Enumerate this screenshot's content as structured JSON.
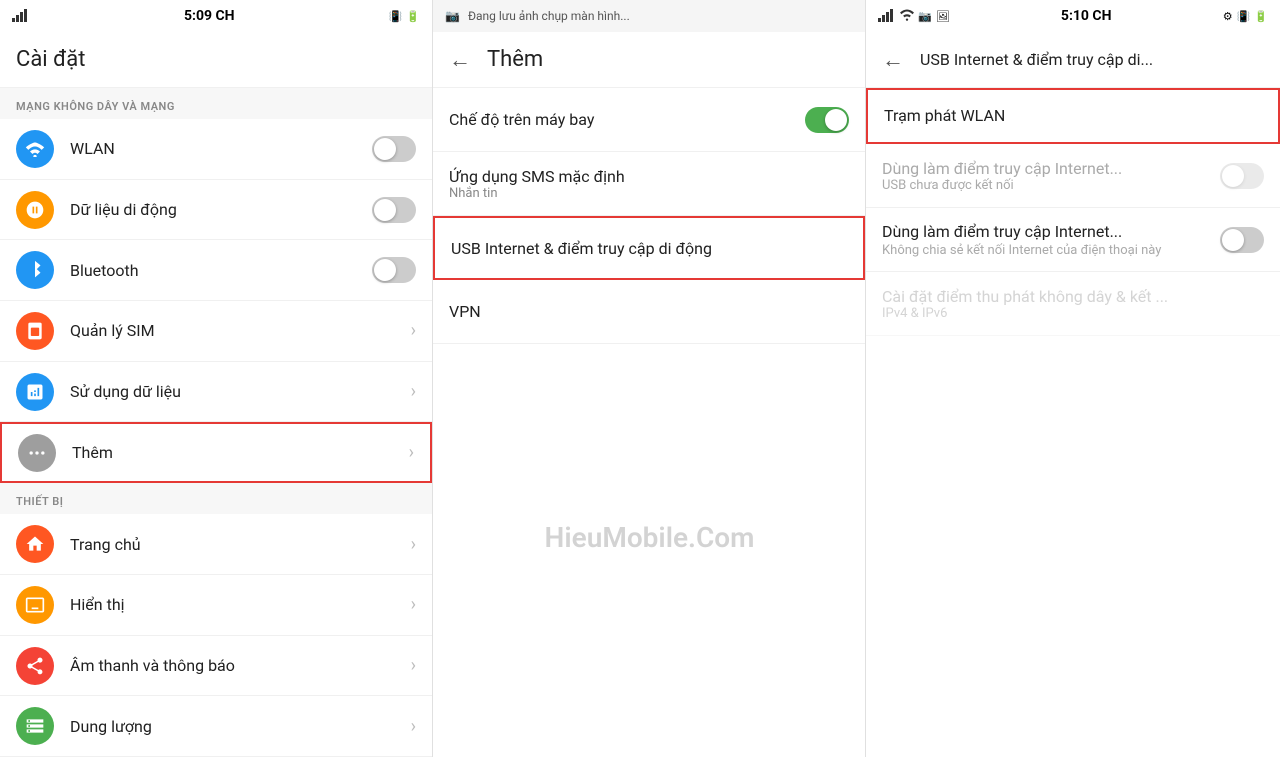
{
  "panel1": {
    "status_time": "5:09 CH",
    "title": "Cài đặt",
    "section1_header": "MẠNG KHÔNG DÂY VÀ MẠNG",
    "items": [
      {
        "id": "wlan",
        "label": "WLAN",
        "icon": "wifi",
        "icon_color": "#2196F3",
        "has_toggle": true,
        "toggle_on": false
      },
      {
        "id": "mobile_data",
        "label": "Dữ liệu di động",
        "icon": "signal",
        "icon_color": "#FF9800",
        "has_toggle": true,
        "toggle_on": false
      },
      {
        "id": "bluetooth",
        "label": "Bluetooth",
        "icon": "bluetooth",
        "icon_color": "#2196F3",
        "has_toggle": true,
        "toggle_on": false
      },
      {
        "id": "sim",
        "label": "Quản lý SIM",
        "icon": "sim",
        "icon_color": "#FF5722",
        "has_toggle": false,
        "has_chevron": true
      },
      {
        "id": "data_usage",
        "label": "Sử dụng dữ liệu",
        "icon": "data",
        "icon_color": "#2196F3",
        "has_toggle": false,
        "has_chevron": true
      },
      {
        "id": "more",
        "label": "Thêm",
        "icon": "more",
        "icon_color": "#9E9E9E",
        "has_toggle": false,
        "has_chevron": true,
        "highlighted": true
      }
    ],
    "section2_header": "THIẾT BỊ",
    "items2": [
      {
        "id": "home",
        "label": "Trang chủ",
        "icon": "home",
        "icon_color": "#FF5722",
        "has_chevron": true
      },
      {
        "id": "display",
        "label": "Hiển thị",
        "icon": "display",
        "icon_color": "#FF9800",
        "has_chevron": true
      },
      {
        "id": "sound",
        "label": "Âm thanh và thông báo",
        "icon": "sound",
        "icon_color": "#F44336",
        "has_chevron": true
      },
      {
        "id": "storage",
        "label": "Dung lượng",
        "icon": "storage",
        "icon_color": "#4CAF50",
        "has_chevron": true
      }
    ]
  },
  "panel2": {
    "status_notification": "Đang lưu ảnh chụp màn hình...",
    "title": "Thêm",
    "items": [
      {
        "id": "airplane",
        "label": "Chế độ trên máy bay",
        "toggle": true,
        "toggle_on": true,
        "highlighted": false
      },
      {
        "id": "sms",
        "label": "Ứng dụng SMS mặc định",
        "sublabel": "Nhắn tin",
        "highlighted": false
      },
      {
        "id": "usb",
        "label": "USB Internet & điểm truy cập di động",
        "highlighted": true
      },
      {
        "id": "vpn",
        "label": "VPN",
        "highlighted": false
      }
    ],
    "watermark": "HieuMobile.Com"
  },
  "panel3": {
    "status_time": "5:10 CH",
    "title": "USB Internet & điểm truy cập di...",
    "items": [
      {
        "id": "wlan_hotspot",
        "label": "Trạm phát WLAN",
        "highlighted": true
      },
      {
        "id": "usb_internet_disabled",
        "label": "Dùng làm điểm truy cập Internet...",
        "sublabel": "USB chưa được kết nối",
        "toggle": true,
        "toggle_on": false,
        "disabled": true
      },
      {
        "id": "usb_internet",
        "label": "Dùng làm điểm truy cập Internet...",
        "sublabel": "Không chia sẻ kết nối Internet của điện thoại này",
        "toggle": true,
        "toggle_on": false,
        "disabled": false
      },
      {
        "id": "wifi_settings",
        "label": "Cài đặt điểm thu phát không dây & kết ...",
        "sublabel": "IPv4 & IPv6",
        "disabled": true
      }
    ]
  }
}
